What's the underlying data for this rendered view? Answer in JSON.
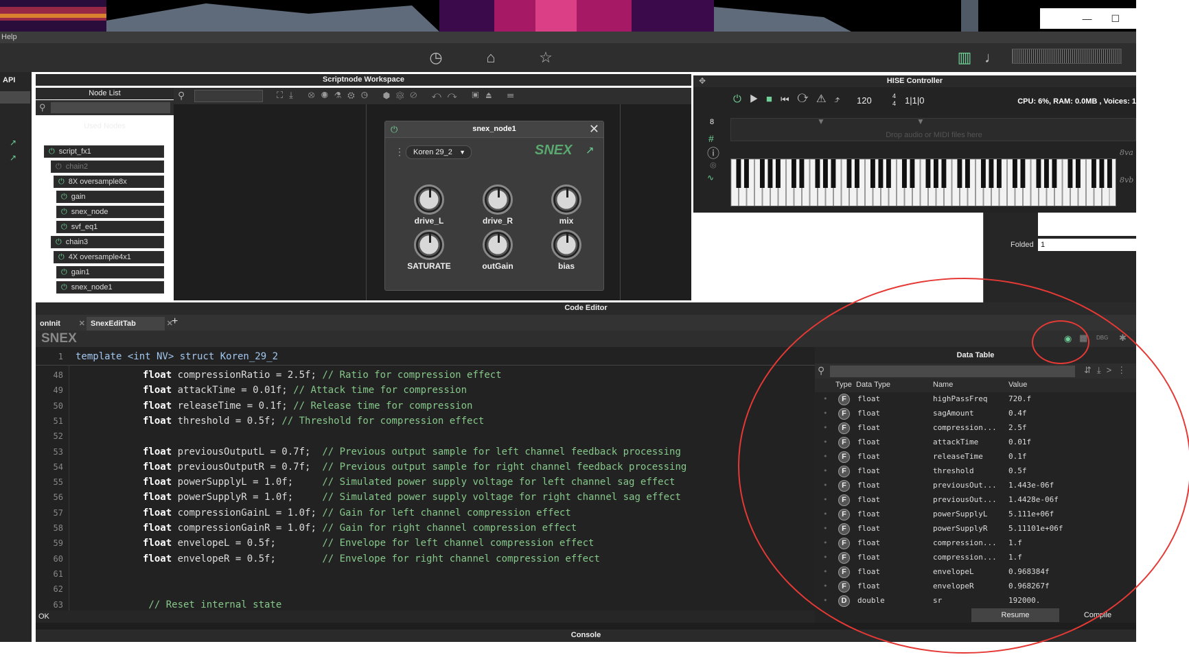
{
  "menu": {
    "help": "Help"
  },
  "toolbar": {
    "icons": [
      "clock-icon",
      "home-icon",
      "star-icon",
      "piano-icon",
      "note-icon"
    ]
  },
  "left": {
    "api": "API"
  },
  "nodelist": {
    "title": "Node List",
    "used_nodes": "Used Nodes",
    "nodes": [
      {
        "label": "script_fx1",
        "on": true,
        "x": 0
      },
      {
        "label": "chain2",
        "on": false,
        "x": 10
      },
      {
        "label": "8X  oversample8x",
        "on": true,
        "x": 14
      },
      {
        "label": "gain",
        "on": true,
        "x": 18
      },
      {
        "label": "snex_node",
        "on": true,
        "x": 18
      },
      {
        "label": "svf_eq1",
        "on": true,
        "x": 18
      },
      {
        "label": "chain3",
        "on": true,
        "x": 10
      },
      {
        "label": "4X  oversample4x1",
        "on": true,
        "x": 14
      },
      {
        "label": "gain1",
        "on": true,
        "x": 18
      },
      {
        "label": "snex_node1",
        "on": true,
        "x": 18
      }
    ]
  },
  "workspace": {
    "title": "Scriptnode Workspace"
  },
  "snexnode": {
    "title": "snex_node1",
    "preset": "Koren 29_2",
    "logo": "SNEX",
    "knobs": [
      "drive_L",
      "drive_R",
      "mix",
      "SATURATE",
      "outGain",
      "bias"
    ]
  },
  "hise": {
    "title": "HISE Controller",
    "tempo": "120",
    "sig_top": "4",
    "sig_bot": "4",
    "position": "1|1|0",
    "stats": "CPU: 6%, RAM: 0.0MB , Voices: 1",
    "bar": "8",
    "drop": "Drop audio or MIDI files here",
    "octave_up": "8va",
    "octave_down": "8vb",
    "folded_label": "Folded",
    "folded_value": "1"
  },
  "codeeditor": {
    "title": "Code Editor",
    "tabs": [
      "onInit",
      "SnexEditTab"
    ],
    "logo": "SNEX",
    "status": "OK",
    "first_line": {
      "no": "1",
      "text": "template <int NV> struct Koren_29_2"
    },
    "lines": [
      {
        "no": "48",
        "kw": "float",
        "code": " compressionRatio = 2.5f; ",
        "cm": "// Ratio for compression effect"
      },
      {
        "no": "49",
        "kw": "float",
        "code": " attackTime = 0.01f; ",
        "cm": "// Attack time for compression"
      },
      {
        "no": "50",
        "kw": "float",
        "code": " releaseTime = 0.1f; ",
        "cm": "// Release time for compression"
      },
      {
        "no": "51",
        "kw": "float",
        "code": " threshold = 0.5f; ",
        "cm": "// Threshold for compression effect"
      },
      {
        "no": "52",
        "kw": "",
        "code": "",
        "cm": ""
      },
      {
        "no": "53",
        "kw": "float",
        "code": " previousOutputL = 0.7f;  ",
        "cm": "// Previous output sample for left channel feedback processing"
      },
      {
        "no": "54",
        "kw": "float",
        "code": " previousOutputR = 0.7f;  ",
        "cm": "// Previous output sample for right channel feedback processing"
      },
      {
        "no": "55",
        "kw": "float",
        "code": " powerSupplyL = 1.0f;     ",
        "cm": "// Simulated power supply voltage for left channel sag effect"
      },
      {
        "no": "56",
        "kw": "float",
        "code": " powerSupplyR = 1.0f;     ",
        "cm": "// Simulated power supply voltage for right channel sag effect"
      },
      {
        "no": "57",
        "kw": "float",
        "code": " compressionGainL = 1.0f; ",
        "cm": "// Gain for left channel compression effect"
      },
      {
        "no": "58",
        "kw": "float",
        "code": " compressionGainR = 1.0f; ",
        "cm": "// Gain for right channel compression effect"
      },
      {
        "no": "59",
        "kw": "float",
        "code": " envelopeL = 0.5f;        ",
        "cm": "// Envelope for left channel compression effect"
      },
      {
        "no": "60",
        "kw": "float",
        "code": " envelopeR = 0.5f;        ",
        "cm": "// Envelope for right channel compression effect"
      },
      {
        "no": "61",
        "kw": "",
        "code": "",
        "cm": ""
      },
      {
        "no": "62",
        "kw": "",
        "code": "",
        "cm": ""
      },
      {
        "no": "63",
        "kw": "",
        "code": "",
        "cm": " // Reset internal state"
      }
    ]
  },
  "datatable": {
    "title": "Data Table",
    "dbg": "DBG",
    "headers": [
      "Type",
      "Data Type",
      "Name",
      "Value"
    ],
    "rows": [
      [
        "F",
        "float",
        "highPassFreq",
        "720.f"
      ],
      [
        "F",
        "float",
        "sagAmount",
        "0.4f"
      ],
      [
        "F",
        "float",
        "compression...",
        "2.5f"
      ],
      [
        "F",
        "float",
        "attackTime",
        "0.01f"
      ],
      [
        "F",
        "float",
        "releaseTime",
        "0.1f"
      ],
      [
        "F",
        "float",
        "threshold",
        "0.5f"
      ],
      [
        "F",
        "float",
        "previousOut...",
        "1.443e-06f"
      ],
      [
        "F",
        "float",
        "previousOut...",
        "1.4428e-06f"
      ],
      [
        "F",
        "float",
        "powerSupplyL",
        "5.111e+06f"
      ],
      [
        "F",
        "float",
        "powerSupplyR",
        "5.11101e+06f"
      ],
      [
        "F",
        "float",
        "compression...",
        "1.f"
      ],
      [
        "F",
        "float",
        "compression...",
        "1.f"
      ],
      [
        "F",
        "float",
        "envelopeL",
        "0.968384f"
      ],
      [
        "F",
        "float",
        "envelopeR",
        "0.968267f"
      ],
      [
        "D",
        "double",
        "sr",
        "192000."
      ]
    ],
    "resume": "Resume",
    "compile": "Compile"
  },
  "console": {
    "title": "Console"
  }
}
